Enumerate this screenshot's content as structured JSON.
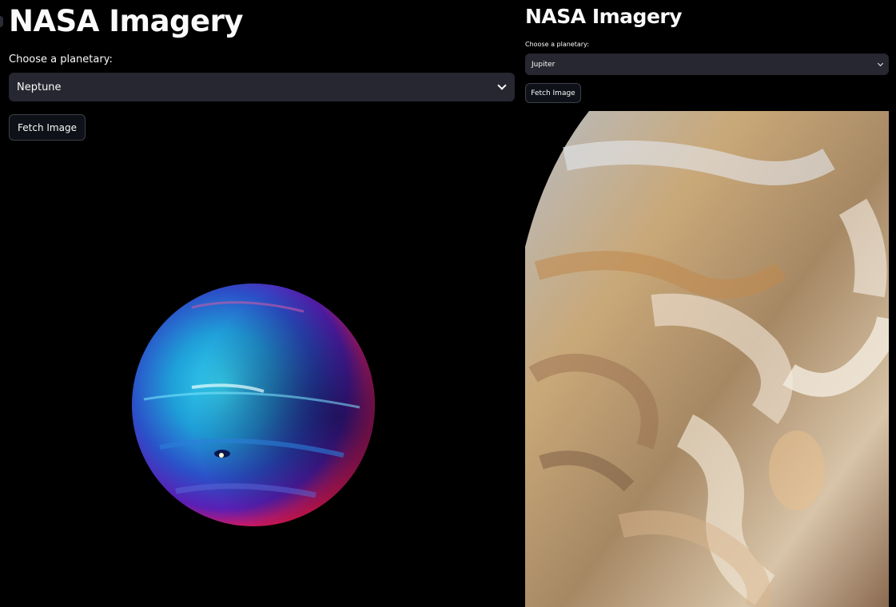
{
  "left_app": {
    "title": "NASA Imagery",
    "select_label": "Choose a planetary:",
    "selected_planet": "Neptune",
    "fetch_button": "Fetch Image",
    "image_icon": "neptune-planet-image"
  },
  "right_app": {
    "title": "NASA Imagery",
    "select_label": "Choose a planetary:",
    "selected_planet": "Jupiter",
    "fetch_button": "Fetch Image",
    "image_icon": "jupiter-cloud-bands-image"
  },
  "colors": {
    "background": "#000000",
    "select_bg": "#262730",
    "button_border": "#3d404a",
    "text": "#fafafa"
  }
}
